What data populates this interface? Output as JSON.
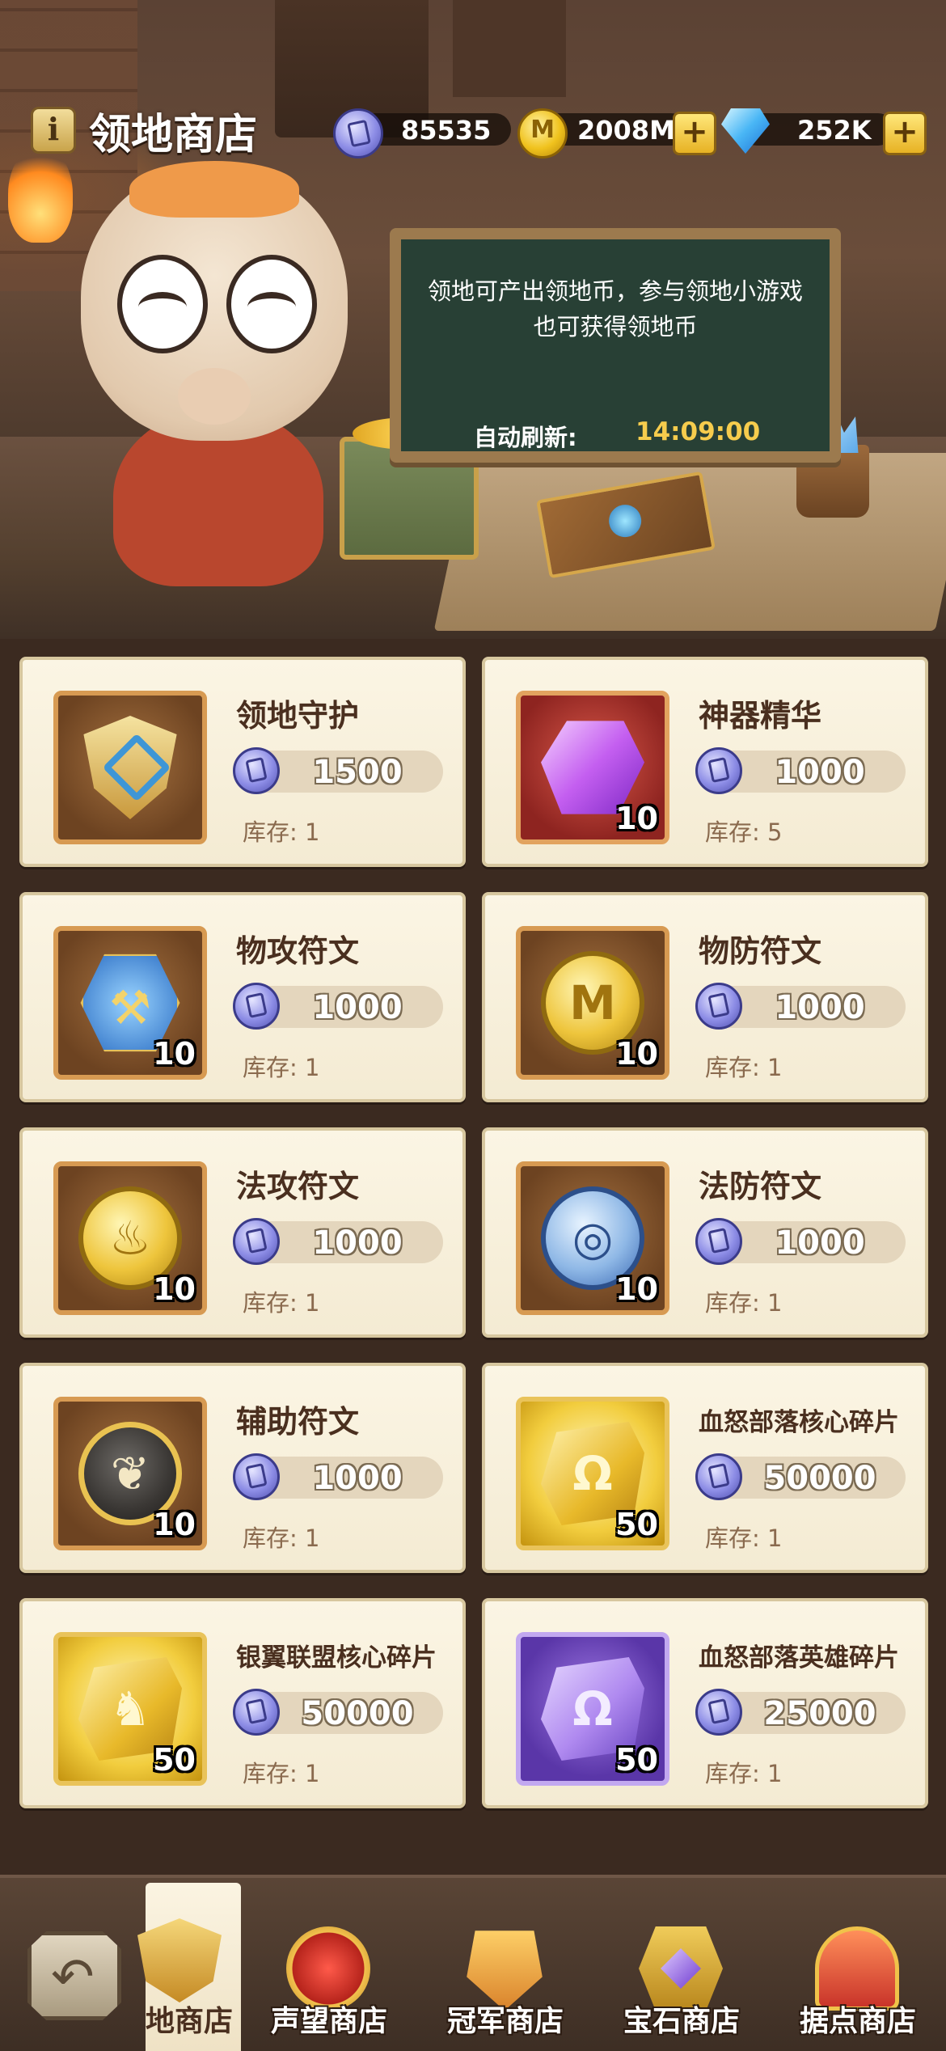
{
  "header": {
    "title": "领地商店",
    "currencies": [
      {
        "icon": "territory-coin-icon",
        "value": "85535"
      },
      {
        "icon": "gold-coin-icon",
        "value": "2008M"
      },
      {
        "icon": "diamond-icon",
        "value": "252K"
      }
    ],
    "plus_label": "+"
  },
  "notice": {
    "description": "领地可产出领地币，参与领地小游戏也可获得领地币",
    "refresh_label": "自动刷新:",
    "refresh_time": "14:09:00"
  },
  "items": [
    {
      "name": "领地守护",
      "price": "1500",
      "stock": "库存: 1",
      "quantity": "",
      "icon": "territory-guard-shield-icon"
    },
    {
      "name": "神器精华",
      "price": "1000",
      "stock": "库存: 5",
      "quantity": "10",
      "icon": "artifact-essence-crystal-icon"
    },
    {
      "name": "物攻符文",
      "price": "1000",
      "stock": "库存: 1",
      "quantity": "10",
      "icon": "physical-attack-rune-icon"
    },
    {
      "name": "物防符文",
      "price": "1000",
      "stock": "库存: 1",
      "quantity": "10",
      "icon": "physical-defense-rune-icon"
    },
    {
      "name": "法攻符文",
      "price": "1000",
      "stock": "库存: 1",
      "quantity": "10",
      "icon": "magic-attack-rune-icon"
    },
    {
      "name": "法防符文",
      "price": "1000",
      "stock": "库存: 1",
      "quantity": "10",
      "icon": "magic-defense-rune-icon"
    },
    {
      "name": "辅助符文",
      "price": "1000",
      "stock": "库存: 1",
      "quantity": "10",
      "icon": "support-rune-icon"
    },
    {
      "name": "血怒部落核心碎片",
      "price": "50000",
      "stock": "库存: 1",
      "quantity": "50",
      "icon": "blood-rage-core-shard-icon"
    },
    {
      "name": "银翼联盟核心碎片",
      "price": "50000",
      "stock": "库存: 1",
      "quantity": "50",
      "icon": "silver-wing-core-shard-icon"
    },
    {
      "name": "血怒部落英雄碎片",
      "price": "25000",
      "stock": "库存: 1",
      "quantity": "50",
      "icon": "blood-rage-hero-shard-icon"
    }
  ],
  "bottom_nav": {
    "back_icon": "back-arrow-icon",
    "tabs": [
      {
        "label": "领地商店",
        "visible_label": "地商店",
        "active": true,
        "icon": "territory-shop-badge-icon"
      },
      {
        "label": "声望商店",
        "active": false,
        "icon": "reputation-shop-badge-icon"
      },
      {
        "label": "冠军商店",
        "active": false,
        "icon": "champion-shop-badge-icon"
      },
      {
        "label": "宝石商店",
        "active": false,
        "icon": "gem-shop-badge-icon"
      },
      {
        "label": "据点商店",
        "active": false,
        "icon": "stronghold-shop-badge-icon"
      }
    ]
  }
}
